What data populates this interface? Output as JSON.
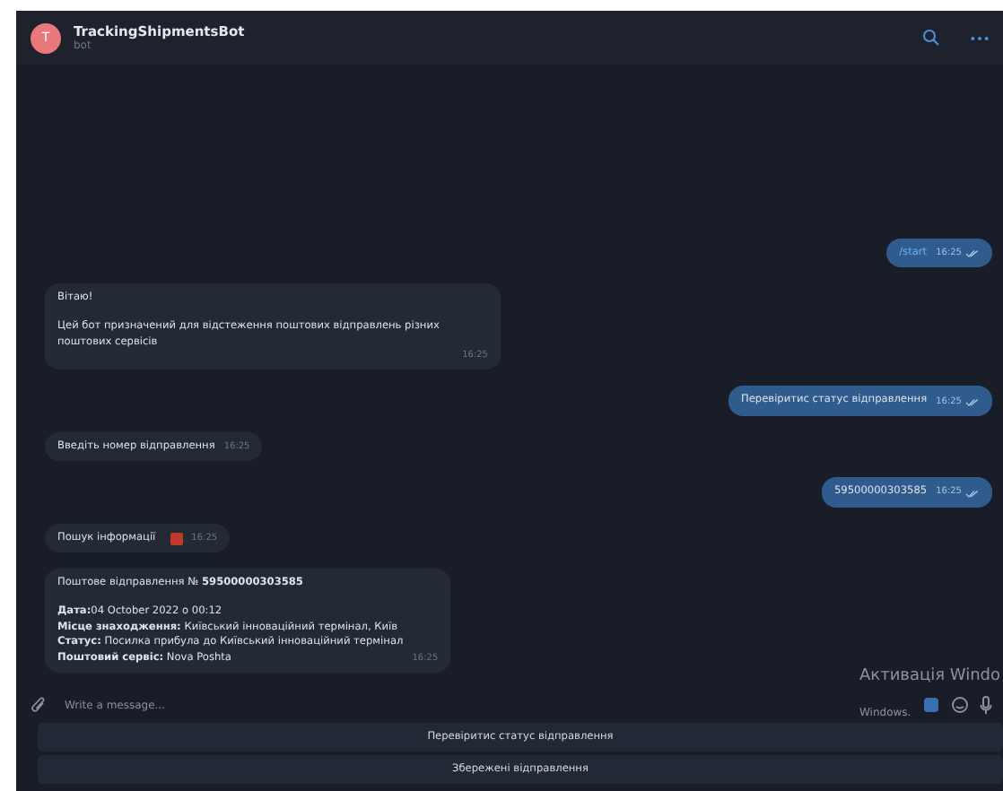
{
  "header": {
    "avatar_letter": "T",
    "title": "TrackingShipmentsBot",
    "subtitle": "bot"
  },
  "messages": [
    {
      "outgoing": true,
      "kind": "command",
      "paragraphs": [
        [
          "/start"
        ]
      ],
      "time": "16:25",
      "read": true
    },
    {
      "outgoing": false,
      "kind": "text",
      "paragraphs": [
        [
          "Вітаю!"
        ],
        [
          "Цей бот призначений для відстеження поштових відправлень різних поштових сервісів"
        ]
      ],
      "time": "16:25"
    },
    {
      "outgoing": true,
      "kind": "text",
      "paragraphs": [
        [
          "Перевіритис статус відправлення"
        ]
      ],
      "time": "16:25",
      "read": true
    },
    {
      "outgoing": false,
      "kind": "text",
      "paragraphs": [
        [
          "Введіть номер відправлення"
        ]
      ],
      "time": "16:25"
    },
    {
      "outgoing": true,
      "kind": "text",
      "paragraphs": [
        [
          "59500000303585"
        ]
      ],
      "time": "16:25",
      "read": true
    },
    {
      "outgoing": false,
      "kind": "search",
      "paragraphs": [
        [
          "Пошук інформації"
        ]
      ],
      "time": "16:25"
    },
    {
      "outgoing": false,
      "kind": "text",
      "paragraphs": [
        [
          "Поштове відправлення № **59500000303585**"
        ],
        [
          "**Дата:**04 October 2022 o 00:12",
          "**Місце знаходження:** Київський інноваційний термінал, Київ",
          "**Статус:** Посилка прибула до Київський інноваційний термінал",
          "**Поштовий сервіс:** Nova Poshta"
        ]
      ],
      "time": "16:25"
    }
  ],
  "composer": {
    "placeholder": "Write a message..."
  },
  "keyboard": [
    "Перевіритис статус відправлення",
    "Збережені відправлення"
  ],
  "os_notice": [
    "Активація Windo",
    "Windows."
  ]
}
